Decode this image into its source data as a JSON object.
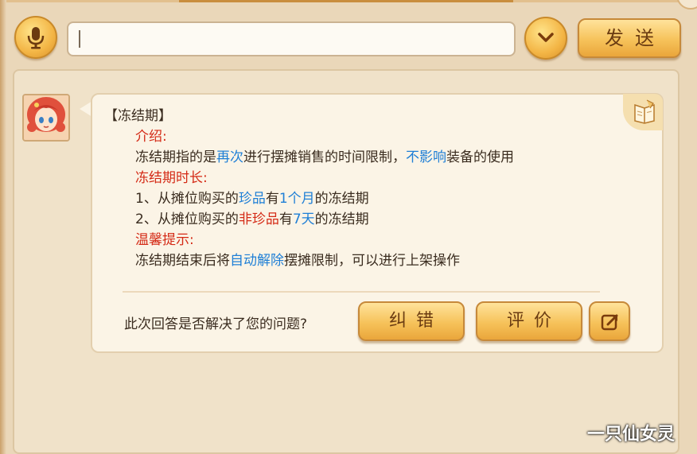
{
  "toolbar": {
    "mic_icon": "microphone-icon",
    "input_value": "",
    "dropdown_icon": "chevron-down-icon",
    "send_label": "发送"
  },
  "message": {
    "title": "【冻结期】",
    "intro_heading": "介绍:",
    "intro_line": {
      "p1": "冻结期指的是",
      "h1": "再次",
      "p2": "进行摆摊销售的时间限制，",
      "h2": "不影响",
      "p3": "装备的使用"
    },
    "duration_heading": "冻结期时长:",
    "duration_line1": {
      "p1": "1、从摊位购买的",
      "h1": "珍品",
      "p2": "有",
      "h2": "1个月",
      "p3": "的冻结期"
    },
    "duration_line2": {
      "p1": "2、从摊位购买的",
      "h1": "非珍品",
      "p2": "有",
      "h2": "7天",
      "p3": "的冻结期"
    },
    "tips_heading": "温馨提示:",
    "tips_line": {
      "p1": "冻结期结束后将",
      "h1": "自动解除",
      "p2": "摆摊限制，可以进行上架操作"
    }
  },
  "feedback": {
    "question": "此次回答是否解决了您的问题?",
    "correct_label": "纠错",
    "rate_label": "评价",
    "share_icon": "share-icon"
  },
  "watermark": "一只仙女灵",
  "colors": {
    "highlight_red": "#d42a16",
    "highlight_blue": "#1f7fd6",
    "button_gold": "#f6c25a",
    "panel_bg": "#f0e2c9"
  }
}
